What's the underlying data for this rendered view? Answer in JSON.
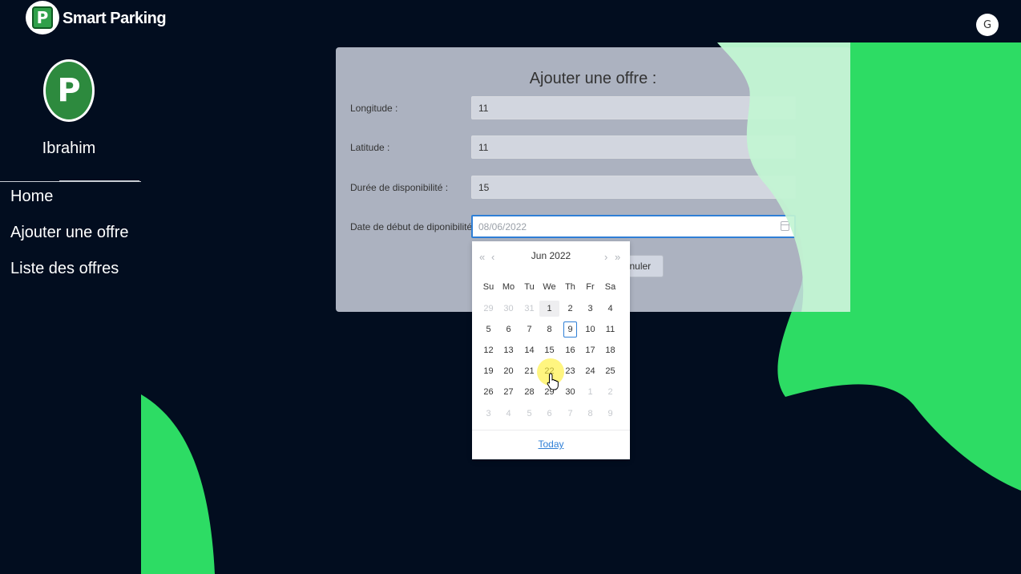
{
  "header": {
    "brand_name": "Smart Parking",
    "account_icon": "G"
  },
  "sidebar": {
    "avatar_letter": "P",
    "username": "Ibrahim",
    "items": [
      {
        "label": "Home"
      },
      {
        "label": "Ajouter une offre"
      },
      {
        "label": "Liste des offres"
      }
    ]
  },
  "form": {
    "title": "Ajouter une offre :",
    "fields": [
      {
        "label": "Longitude :",
        "value": "11"
      },
      {
        "label": "Latitude :",
        "value": "11"
      },
      {
        "label": "Durée de disponibilité :",
        "value": "15"
      },
      {
        "label": "Date de début de diponibilité :",
        "value": "08/06/2022"
      }
    ],
    "cancel_label": "Annuler"
  },
  "datepicker": {
    "month": "Jun",
    "year": "2022",
    "weekdays": [
      "Su",
      "Mo",
      "Tu",
      "We",
      "Th",
      "Fr",
      "Sa"
    ],
    "weeks": [
      [
        "29",
        "30",
        "31",
        "1",
        "2",
        "3",
        "4"
      ],
      [
        "5",
        "6",
        "7",
        "8",
        "9",
        "10",
        "11"
      ],
      [
        "12",
        "13",
        "14",
        "15",
        "16",
        "17",
        "18"
      ],
      [
        "19",
        "20",
        "21",
        "22",
        "23",
        "24",
        "25"
      ],
      [
        "26",
        "27",
        "28",
        "29",
        "30",
        "1",
        "2"
      ],
      [
        "3",
        "4",
        "5",
        "6",
        "7",
        "8",
        "9"
      ]
    ],
    "today_label": "Today"
  },
  "colors": {
    "background": "#020d1f",
    "accent_green": "#2ddc64",
    "link_blue": "#2f7fd6"
  }
}
